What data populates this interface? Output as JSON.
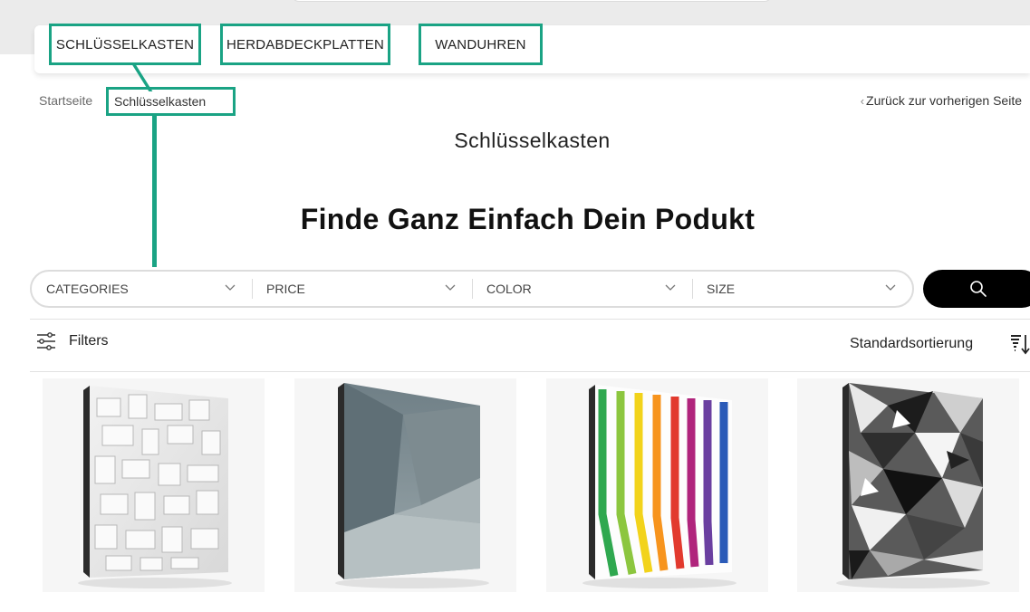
{
  "nav": {
    "items": [
      {
        "label": "SCHLÜSSELKASTEN"
      },
      {
        "label": "HERDABDECKPLATTEN"
      },
      {
        "label": "WANDUHREN"
      }
    ]
  },
  "breadcrumb": {
    "home": "Startseite",
    "current": "Schlüsselkasten"
  },
  "back_link": "Zurück zur vorherigen Seite",
  "page_title": "Schlüsselkasten",
  "hero_heading": "Finde Ganz Einfach Dein Podukt",
  "filter_bar": {
    "segments": [
      {
        "label": "CATEGORIES"
      },
      {
        "label": "PRICE"
      },
      {
        "label": "COLOR"
      },
      {
        "label": "SIZE"
      }
    ]
  },
  "toolbar": {
    "filters_label": "Filters",
    "sort_label": "Standardsortierung"
  },
  "products": [
    {
      "image": "white-cubes-pattern"
    },
    {
      "image": "grey-geometric-concrete"
    },
    {
      "image": "rainbow-stripes"
    },
    {
      "image": "black-white-triangles"
    }
  ],
  "colors": {
    "annotation": "#1aa384",
    "search_button": "#000000"
  }
}
